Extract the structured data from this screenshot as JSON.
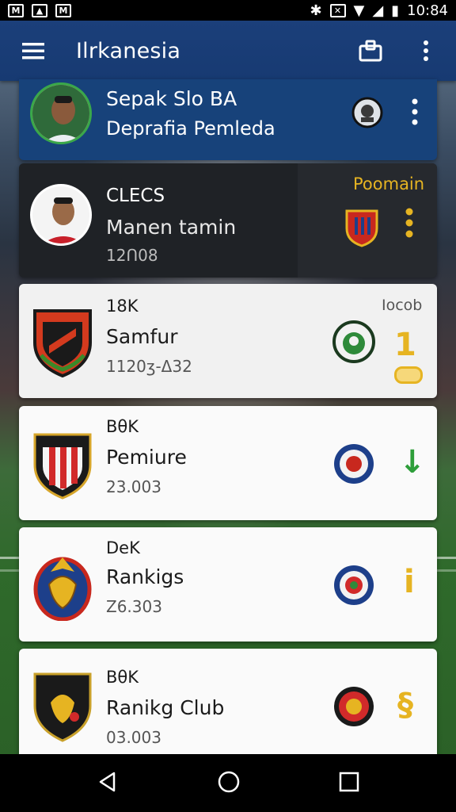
{
  "status_bar": {
    "time": "10:84"
  },
  "app_bar": {
    "title": "Ilrkanesia"
  },
  "cards": [
    {
      "title": "Sepak Slo BA",
      "subtitle": "Deprafia Pemleda"
    },
    {
      "title": "CLECS",
      "subtitle": "Manen tamin",
      "value": "12Ո08",
      "label": "Poomain"
    },
    {
      "meta": "18K",
      "title": "Samfur",
      "value": "1120ʒ-Δ32",
      "label": "Iocob",
      "side_glyph": "1"
    },
    {
      "meta": "BθK",
      "title": "Pemiure",
      "value": "23.003",
      "side_glyph": "↓"
    },
    {
      "meta": "DeK",
      "title": "Rankigs",
      "value": "Z6.303",
      "side_glyph": "i"
    },
    {
      "meta": "BθK",
      "title": "Ranikg Club",
      "value": "03.003",
      "side_glyph": "§"
    }
  ],
  "colors": {
    "app_bar": "#1b3f7a",
    "accent_gold": "#e6b422",
    "accent_green": "#2e9e3a"
  }
}
